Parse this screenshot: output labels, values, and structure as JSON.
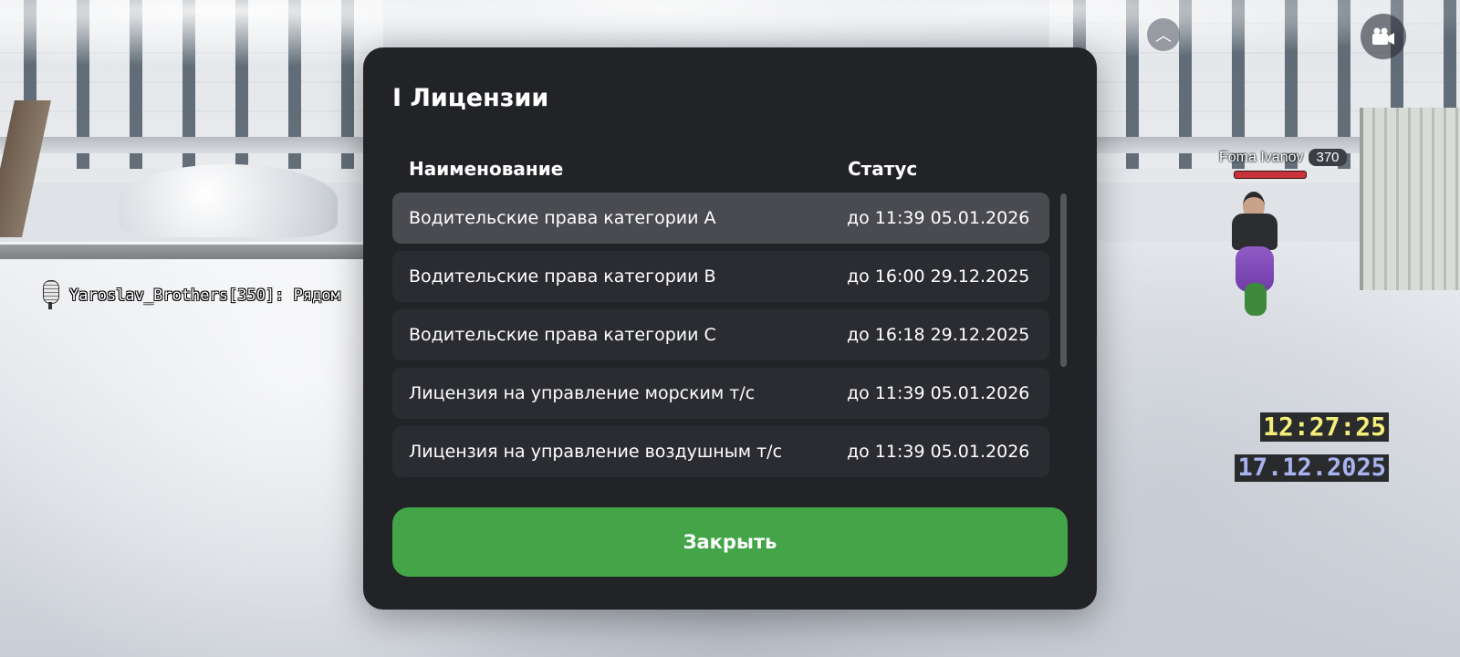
{
  "hud": {
    "player_name": "Foma Ivanov",
    "player_id": "370",
    "voice_text": "Yaroslav_Brothers[350]: Рядом",
    "clock": "12:27:25",
    "date": "17.12.2025"
  },
  "icons": {
    "collapse": "chevron-up-icon",
    "camera": "camera-icon",
    "mic": "microphone-icon"
  },
  "colors": {
    "modal_bg": "#222327",
    "row_bg": "#2b2c31",
    "row_selected_bg": "#4a4b51",
    "close_button": "#43a448",
    "clock": "#f4ef7a",
    "date": "#a9b3f0"
  },
  "modal": {
    "title": "I Лицензии",
    "columns": {
      "name": "Наименование",
      "status": "Статус"
    },
    "rows": [
      {
        "name": "Водительские права категории A",
        "status": "до 11:39 05.01.2026"
      },
      {
        "name": "Водительские права категории B",
        "status": "до 16:00 29.12.2025"
      },
      {
        "name": "Водительские права категории C",
        "status": "до 16:18 29.12.2025"
      },
      {
        "name": "Лицензия на управление морским т/с",
        "status": "до 11:39 05.01.2026"
      },
      {
        "name": "Лицензия на управление воздушным т/с",
        "status": "до 11:39 05.01.2026"
      }
    ],
    "close_label": "Закрыть"
  }
}
